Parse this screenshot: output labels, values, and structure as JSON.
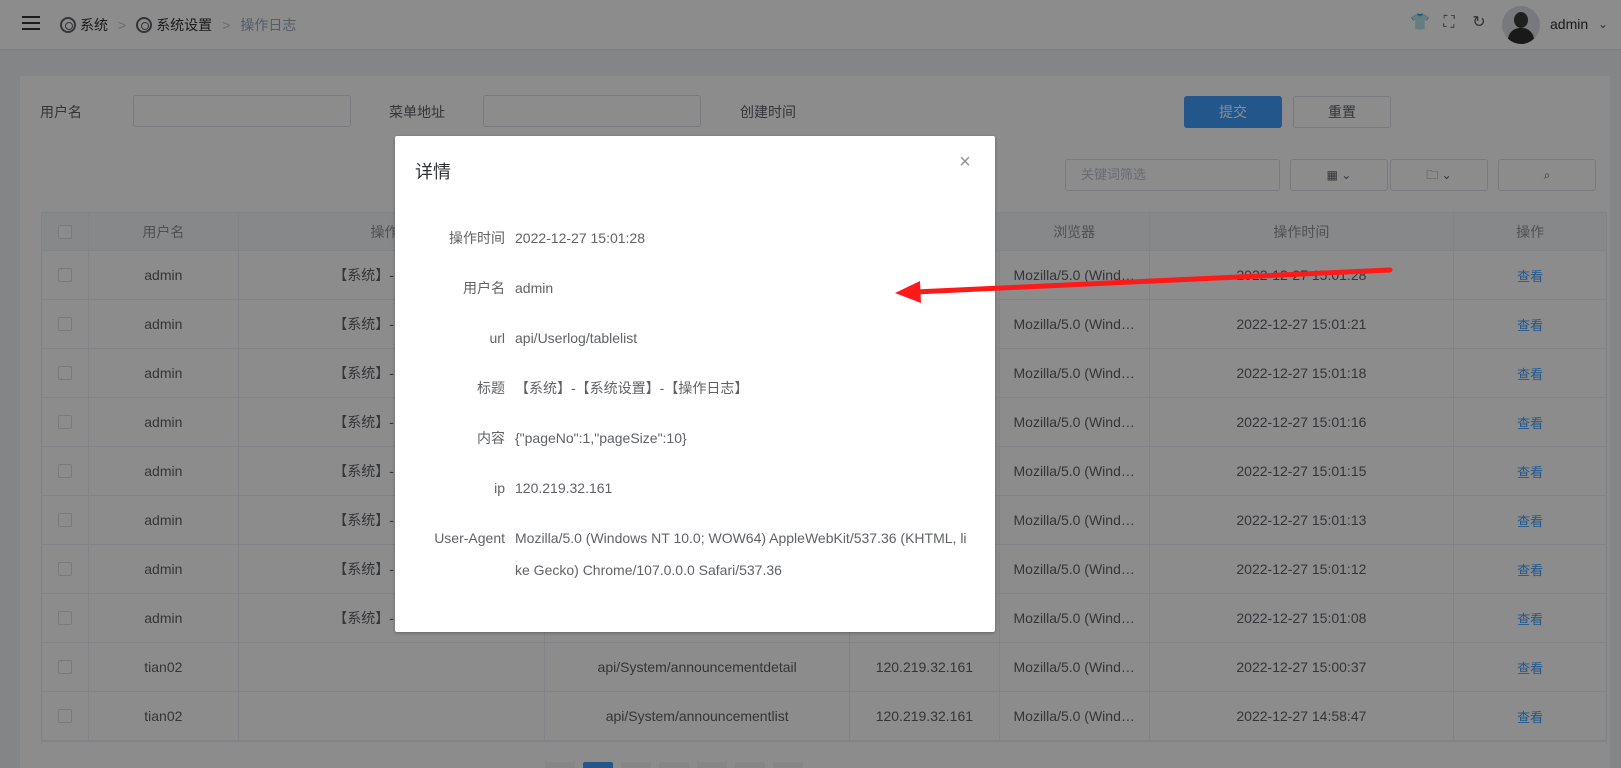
{
  "header": {
    "breadcrumbs": [
      "系统",
      "系统设置",
      "操作日志"
    ],
    "user": "admin"
  },
  "filters": {
    "username_label": "用户名",
    "menu_label": "菜单地址",
    "created_label": "创建时间",
    "submit": "提交",
    "reset": "重置",
    "keyword_placeholder": "关键词筛选"
  },
  "table": {
    "columns": [
      "用户名",
      "操作名",
      "",
      "",
      "浏览器",
      "操作时间",
      "操作"
    ],
    "rows": [
      {
        "user": "admin",
        "title": "【系统】-【系统设",
        "url": "",
        "ip": "",
        "browser": "Mozilla/5.0 (Wind…",
        "time": "2022-12-27 15:01:28",
        "action": "查看"
      },
      {
        "user": "admin",
        "title": "【系统】-【系统设",
        "url": "",
        "ip": "",
        "browser": "Mozilla/5.0 (Wind…",
        "time": "2022-12-27 15:01:21",
        "action": "查看"
      },
      {
        "user": "admin",
        "title": "【系统】-【系统设",
        "url": "",
        "ip": "",
        "browser": "Mozilla/5.0 (Wind…",
        "time": "2022-12-27 15:01:18",
        "action": "查看"
      },
      {
        "user": "admin",
        "title": "【系统】-【系统设",
        "url": "",
        "ip": "",
        "browser": "Mozilla/5.0 (Wind…",
        "time": "2022-12-27 15:01:16",
        "action": "查看"
      },
      {
        "user": "admin",
        "title": "【系统】-【系统设",
        "url": "",
        "ip": "",
        "browser": "Mozilla/5.0 (Wind…",
        "time": "2022-12-27 15:01:15",
        "action": "查看"
      },
      {
        "user": "admin",
        "title": "【系统】-【系统设",
        "url": "",
        "ip": "",
        "browser": "Mozilla/5.0 (Wind…",
        "time": "2022-12-27 15:01:13",
        "action": "查看"
      },
      {
        "user": "admin",
        "title": "【系统】-【系统设",
        "url": "",
        "ip": "",
        "browser": "Mozilla/5.0 (Wind…",
        "time": "2022-12-27 15:01:12",
        "action": "查看"
      },
      {
        "user": "admin",
        "title": "【系统】-【系统设",
        "url": "",
        "ip": "",
        "browser": "Mozilla/5.0 (Wind…",
        "time": "2022-12-27 15:01:08",
        "action": "查看"
      },
      {
        "user": "tian02",
        "title": "",
        "url": "api/System/announcementdetail",
        "ip": "120.219.32.161",
        "browser": "Mozilla/5.0 (Wind…",
        "time": "2022-12-27 15:00:37",
        "action": "查看"
      },
      {
        "user": "tian02",
        "title": "",
        "url": "api/System/announcementlist",
        "ip": "120.219.32.161",
        "browser": "Mozilla/5.0 (Wind…",
        "time": "2022-12-27 14:58:47",
        "action": "查看"
      }
    ]
  },
  "dialog": {
    "title": "详情",
    "fields": [
      {
        "key": "操作时间",
        "value": "2022-12-27 15:01:28"
      },
      {
        "key": "用户名",
        "value": "admin"
      },
      {
        "key": "url",
        "value": "api/Userlog/tablelist"
      },
      {
        "key": "标题",
        "value": "【系统】-【系统设置】-【操作日志】"
      },
      {
        "key": "内容",
        "value": "{\"pageNo\":1,\"pageSize\":10}"
      },
      {
        "key": "ip",
        "value": "120.219.32.161"
      },
      {
        "key": "User-Agent",
        "value": "Mozilla/5.0 (Windows NT 10.0; WOW64) AppleWebKit/537.36 (KHTML, like Gecko) Chrome/107.0.0.0 Safari/537.36"
      }
    ]
  },
  "colors": {
    "accent": "#409eff",
    "annotation": "#ff0000"
  }
}
